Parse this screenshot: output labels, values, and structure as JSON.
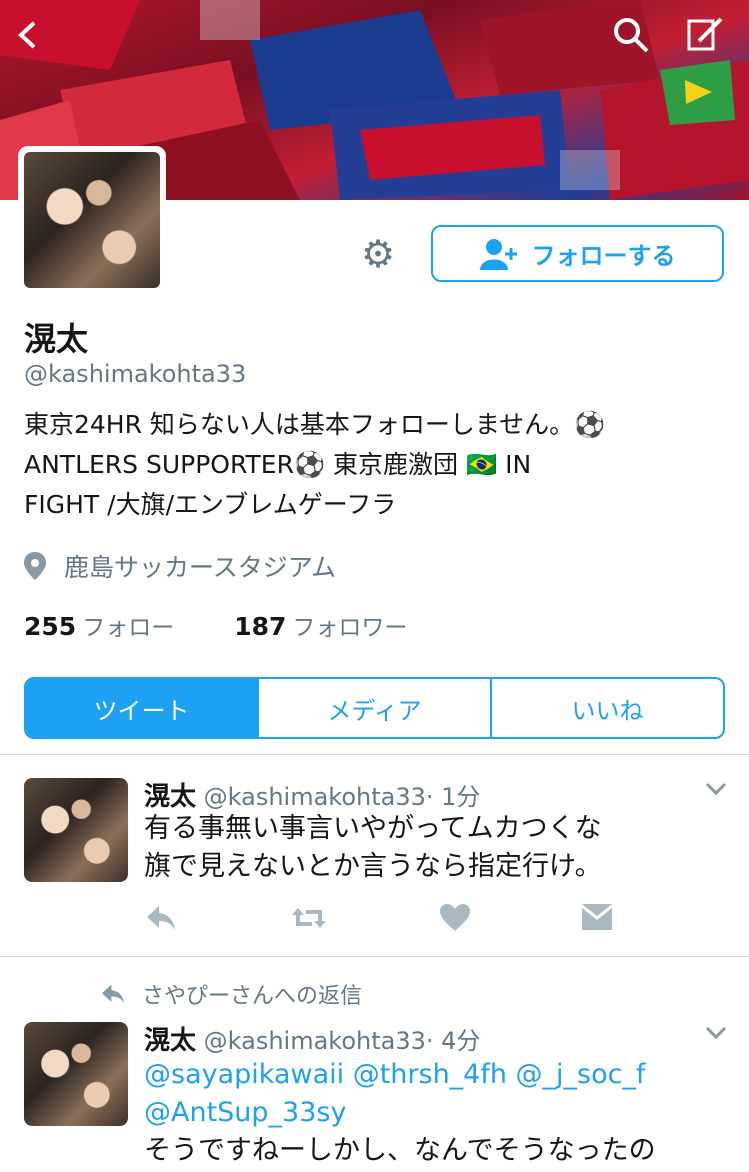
{
  "header": {
    "back_icon": "chevron-left-icon",
    "search_icon": "search-icon",
    "compose_icon": "compose-icon"
  },
  "profile": {
    "name": "滉太",
    "handle": "@kashimakohta33",
    "bio_line1": "東京24HR 知らない人は基本フォローしません。⚽",
    "bio_line2": "ANTLERS SUPPORTER⚽ 東京鹿激団 🇧🇷 IN",
    "bio_line3": "FIGHT /大旗/エンブレムゲーフラ",
    "location": "鹿島サッカースタジアム",
    "following_count": "255",
    "following_label": "フォロー",
    "followers_count": "187",
    "followers_label": "フォロワー",
    "follow_button": "フォローする"
  },
  "tabs": [
    {
      "label": "ツイート"
    },
    {
      "label": "メディア"
    },
    {
      "label": "いいね"
    }
  ],
  "tweets": [
    {
      "name": "滉太",
      "handle": "@kashimakohta33",
      "time": "· 1分",
      "line1": "有る事無い事言いやがってムカつくな",
      "line2": "旗で見えないとか言うなら指定行け。"
    },
    {
      "reply_context": "さやぴーさんへの返信",
      "name": "滉太",
      "handle": "@kashimakohta33",
      "time": "· 4分",
      "line1": "@sayapikawaii @thrsh_4fh @_j_soc_f",
      "line2": "@AntSup_33sy",
      "line3": "そうですねーしかし、なんでそうなったの"
    }
  ],
  "colors": {
    "accent": "#1da1f2",
    "muted": "#657786"
  }
}
